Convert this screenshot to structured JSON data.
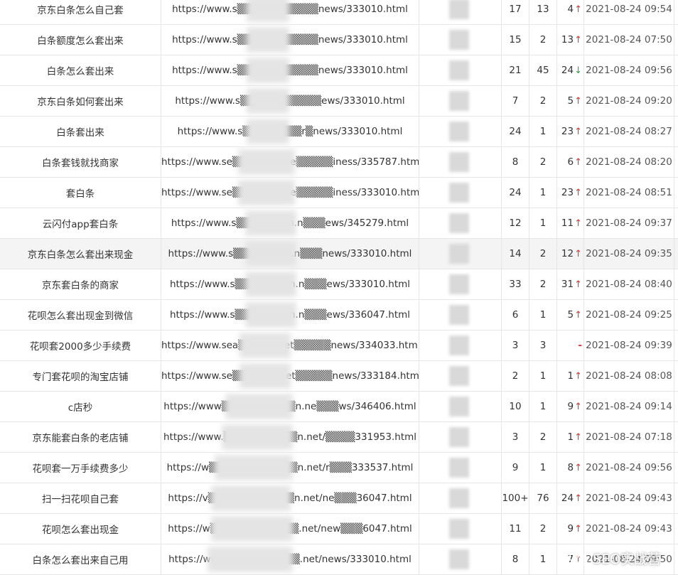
{
  "rows": [
    {
      "keyword": "京东白条怎么自己套",
      "url": "https://www.s▒▒▒▒▒▒▒▒▒▒▒news/333010.html",
      "col_a": "17",
      "col_b": "13",
      "col_c": "4",
      "trend": "up",
      "time": "2021-08-24 09:54"
    },
    {
      "keyword": "白条额度怎么套出来",
      "url": "https://www.s▒▒▒▒▒▒▒▒▒▒▒news/333010.html",
      "col_a": "15",
      "col_b": "2",
      "col_c": "13",
      "trend": "up",
      "time": "2021-08-24 07:50"
    },
    {
      "keyword": "白条怎么套出来",
      "url": "https://www.s▒▒▒▒▒▒▒▒▒▒▒news/333010.html",
      "col_a": "21",
      "col_b": "45",
      "col_c": "24",
      "trend": "down",
      "time": "2021-08-24 09:56"
    },
    {
      "keyword": "京东白条如何套出来",
      "url": "https://www.s▒▒▒▒▒▒▒▒▒▒▒ews/333010.html",
      "col_a": "7",
      "col_b": "2",
      "col_c": "5",
      "trend": "up",
      "time": "2021-08-24 09:20"
    },
    {
      "keyword": "白条套出来",
      "url": "https://www.s▒▒▒▒▒▒▒▒r▒news/333010.html",
      "col_a": "24",
      "col_b": "1",
      "col_c": "23",
      "trend": "up",
      "time": "2021-08-24 08:27"
    },
    {
      "keyword": "白条套钱就找商家",
      "url": "https://www.se▒▒▒▒▒▒▒ne▒▒▒▒▒iness/335787.html",
      "col_a": "8",
      "col_b": "2",
      "col_c": "6",
      "trend": "up",
      "time": "2021-08-24 08:20"
    },
    {
      "keyword": "套白条",
      "url": "https://www.se▒▒▒▒▒▒▒ne▒▒▒▒▒iness/333010.html",
      "col_a": "24",
      "col_b": "1",
      "col_c": "23",
      "trend": "up",
      "time": "2021-08-24 08:51"
    },
    {
      "keyword": "云闪付app套白条",
      "url": "https://www.s▒▒▒▒▒▒▒n.n▒▒▒ews/345279.html",
      "col_a": "12",
      "col_b": "1",
      "col_c": "11",
      "trend": "up",
      "time": "2021-08-24 09:37"
    },
    {
      "keyword": "京东白条怎么套出来现金",
      "url": "https://www.s▒▒▒▒▒▒▒n.n▒▒▒news/333010.html",
      "col_a": "14",
      "col_b": "2",
      "col_c": "12",
      "trend": "up",
      "time": "2021-08-24 09:35"
    },
    {
      "keyword": "京东套白条的商家",
      "url": "https://www.s▒▒▒▒▒▒▒in.n▒▒▒ews/333010.html",
      "col_a": "33",
      "col_b": "2",
      "col_c": "31",
      "trend": "up",
      "time": "2021-08-24 08:40"
    },
    {
      "keyword": "花呗怎么套出现金到微信",
      "url": "https://www.s▒▒▒▒▒▒▒in.n▒▒▒ews/336047.html",
      "col_a": "6",
      "col_b": "1",
      "col_c": "5",
      "trend": "up",
      "time": "2021-08-24 09:25"
    },
    {
      "keyword": "花呗套2000多少手续费",
      "url": "https://www.sea▒▒▒▒▒.net▒▒▒▒▒news/334033.html",
      "col_a": "3",
      "col_b": "3",
      "col_c": "-",
      "trend": "none",
      "time": "2021-08-24 09:39"
    },
    {
      "keyword": "专门套花呗的淘宝店铺",
      "url": "https://www.se▒▒▒▒▒▒.net▒▒▒▒▒news/333184.html",
      "col_a": "2",
      "col_b": "1",
      "col_c": "1",
      "trend": "up",
      "time": "2021-08-24 08:08"
    },
    {
      "keyword": "c店秒",
      "url": "https://www▒▒▒▒▒▒▒▒▒▒n.ne▒▒▒ws/346406.html",
      "col_a": "10",
      "col_b": "1",
      "col_c": "9",
      "trend": "up",
      "time": "2021-08-24 09:14"
    },
    {
      "keyword": "京东能套白条的老店铺",
      "url": "https://www.▒▒▒▒▒▒▒▒▒▒n.net/▒▒▒▒331953.html",
      "col_a": "3",
      "col_b": "2",
      "col_c": "1",
      "trend": "up",
      "time": "2021-08-24 07:18"
    },
    {
      "keyword": "花呗套一万手续费多少",
      "url": "https://w▒▒▒▒▒▒▒▒▒▒▒▒n.net/r▒▒▒333537.html",
      "col_a": "9",
      "col_b": "1",
      "col_c": "8",
      "trend": "up",
      "time": "2021-08-24 09:56"
    },
    {
      "keyword": "扫一扫花呗自己套",
      "url": "https://v▒▒▒▒▒▒s▒▒▒▒▒n.net/ne▒▒▒36047.html",
      "col_a": "100+",
      "col_b": "76",
      "col_c": "24",
      "trend": "up",
      "time": "2021-08-24 09:43"
    },
    {
      "keyword": "花呗怎么套出现金",
      "url": "https://w▒▒▒▒▒▒▒▒▒▒▒▒.net/new▒▒▒6047.html",
      "col_a": "11",
      "col_b": "2",
      "col_c": "9",
      "trend": "up",
      "time": "2021-08-24 09:43"
    },
    {
      "keyword": "白条怎么套出来自己用",
      "url": "https://ww▒▒▒▒▒▒▒▒▒▒▒.net/news/333010.html",
      "col_a": "8",
      "col_b": "1",
      "col_c": "7",
      "trend": "up",
      "time": "2021-08-24 09:50"
    }
  ],
  "highlighted_row": 8,
  "symbols": {
    "up": "↑",
    "down": "↓",
    "none": ""
  },
  "watermark": {
    "text": "SEO实战营",
    "icon": "wechat-icon"
  },
  "colors": {
    "up": "#e5322d",
    "down": "#28a745",
    "border": "#e6e6e6",
    "highlight": "#f4f4f4"
  }
}
